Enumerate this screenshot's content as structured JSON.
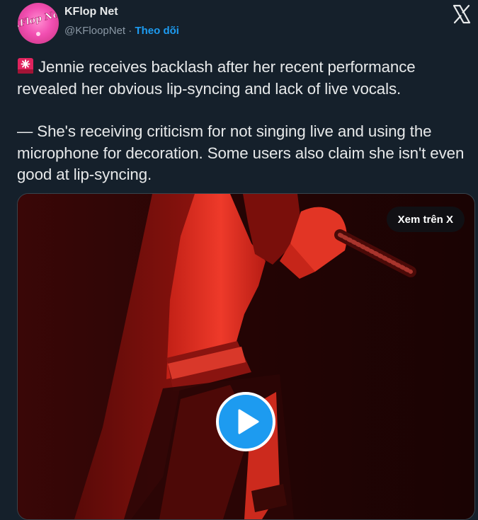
{
  "author": {
    "name": "KFlop Net",
    "handle": "@KFloopNet",
    "separator": " · ",
    "follow_label": "Theo dõi",
    "avatar_text": "KFlop Net"
  },
  "tweet": {
    "paragraph1": "Jennie receives backlash after her recent performance revealed her obvious lip-syncing and lack of live vocals.",
    "paragraph2": "— She's receiving criticism for not singing live and using the microphone for decoration. Some users also claim she isn't even good at lip-syncing."
  },
  "media": {
    "watch_label": "Xem trên X"
  },
  "icons": {
    "platform": "x-logo-icon",
    "emoji": "siren-icon",
    "play": "play-icon"
  },
  "colors": {
    "background": "#15202b",
    "text": "#e7e9ea",
    "muted": "#8b98a5",
    "accent": "#1d9bf0"
  }
}
